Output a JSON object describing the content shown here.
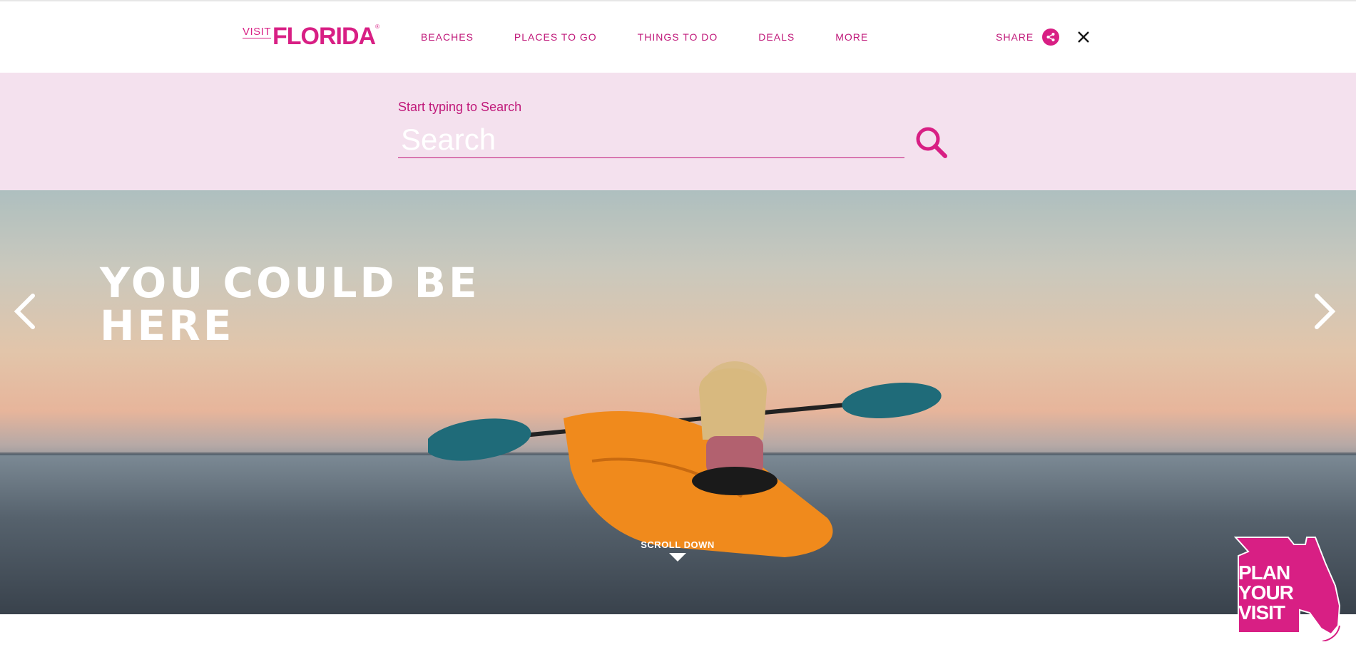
{
  "header": {
    "logo": {
      "visit": "VISIT",
      "brand": "FLORIDA",
      "reg": "®"
    },
    "nav": [
      {
        "label": "BEACHES"
      },
      {
        "label": "PLACES TO GO"
      },
      {
        "label": "THINGS TO DO"
      },
      {
        "label": "DEALS"
      },
      {
        "label": "MORE"
      }
    ],
    "share_label": "SHARE"
  },
  "search": {
    "caption": "Start typing to Search",
    "placeholder": "Search",
    "value": ""
  },
  "hero": {
    "title_line1": "YOU COULD BE",
    "title_line2": "HERE",
    "scroll_label": "SCROLL DOWN"
  },
  "plan_badge": {
    "line1": "PLAN",
    "line2": "YOUR",
    "line3": "VISIT"
  },
  "colors": {
    "brand": "#d81f84",
    "search_band": "#f4e1ee"
  },
  "icons": [
    "share-icon",
    "close-icon",
    "search-icon",
    "chevron-left-icon",
    "chevron-right-icon",
    "scroll-down-arrow-icon",
    "florida-map-icon"
  ]
}
